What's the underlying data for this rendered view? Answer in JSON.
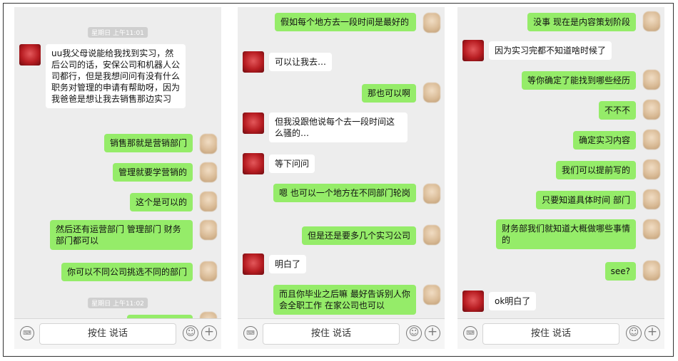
{
  "input_bar": {
    "hold_to_talk": "按住 说话",
    "keyboard_icon": "keyboard-icon",
    "emoji_icon": "emoji-icon",
    "plus_icon": "plus-icon"
  },
  "panels": [
    {
      "times": [
        "星期日 上午11:01",
        "星期日 上午11:02"
      ],
      "messages": [
        "uu我父母说能给我找到实习，然后公司的话，安保公司和机器人公司都行，但是我想问问有没有什么职务对管理的申请有帮助呀，因为我爸爸是想让我去销售那边实习",
        "销售那就是营销部门",
        "管理就要学营销的",
        "这个是可以的",
        "然后还有运营部门 管理部门 财务部门都可以",
        "你可以不同公司挑选不同的部门"
      ]
    },
    {
      "messages": [
        "假如每个地方去一段时间是最好的",
        "可以让我去…",
        "那也可以啊",
        "但我没跟他说每个去一段时间这么骚的…",
        "等下问问",
        "嗯 也可以一个地方在不同部门轮岗",
        "但是还是要多几个实习公司",
        "明白了",
        "而且你毕业之后嘛 最好告诉别人你会全职工作 在家公司也可以"
      ]
    },
    {
      "messages": [
        "没事 现在是内容策划阶段",
        "因为实习完都不知道啥时候了",
        "等你确定了能找到哪些经历",
        "不不不",
        "确定实习内容",
        "我们可以提前写的",
        "只要知道具体时间 部门",
        "财务部我们就知道大概做哪些事情的",
        "see?",
        "ok明白了"
      ]
    }
  ]
}
